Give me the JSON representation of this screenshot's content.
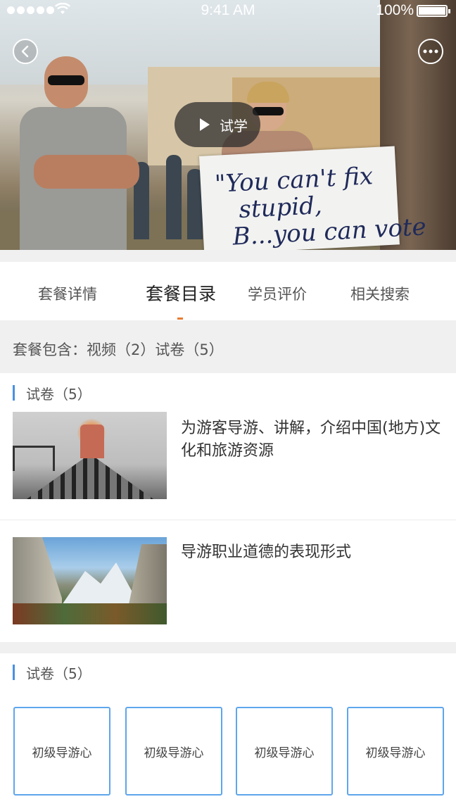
{
  "status_bar": {
    "time": "9:41 AM",
    "battery": "100%"
  },
  "hero": {
    "trial_label": "试学",
    "sign_text": "\"You can't fix\n   stupid,\n  B...you can vote"
  },
  "tabs": [
    {
      "label": "套餐详情",
      "active": false
    },
    {
      "label": "套餐目录",
      "active": true
    },
    {
      "label": "学员评价",
      "active": false
    },
    {
      "label": "相关搜索",
      "active": false
    }
  ],
  "package_summary": "套餐包含：视频（2）试卷（5）",
  "section1": {
    "title": "试卷（5）",
    "items": [
      {
        "title": "为游客导游、讲解，介绍中国(地方)文化和旅游资源",
        "thumb": "train-image"
      },
      {
        "title": "导游职业道德的表现形式",
        "thumb": "valley-image"
      }
    ]
  },
  "section2": {
    "title": "试卷（5）",
    "cards": [
      {
        "label": "初级导游心"
      },
      {
        "label": "初级导游心"
      },
      {
        "label": "初级导游心"
      },
      {
        "label": "初级导游心"
      }
    ]
  },
  "colors": {
    "accent_blue": "#4a90e2",
    "card_border": "#5ea6ec",
    "tab_indicator": "#e87c33",
    "background_gray": "#f0f0f0"
  },
  "icons": {
    "back": "chevron-left-icon",
    "more": "more-dots-icon",
    "play": "play-icon",
    "wifi": "wifi-icon"
  }
}
